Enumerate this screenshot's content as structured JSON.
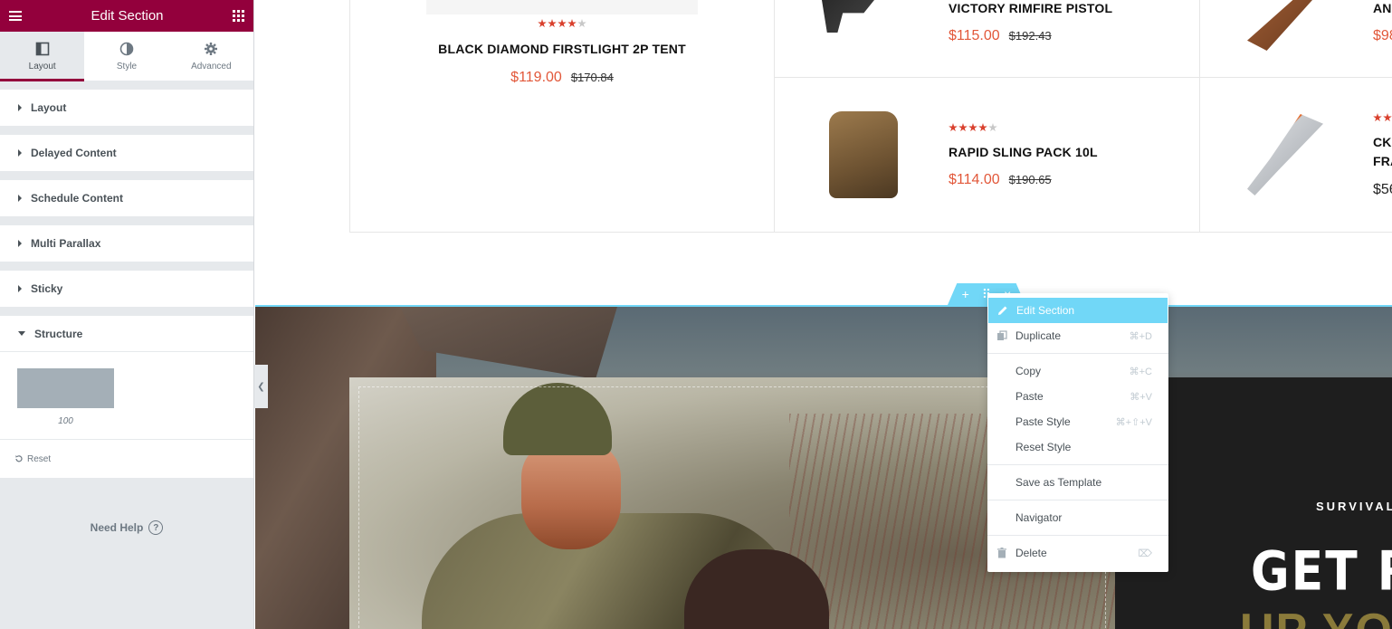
{
  "editor": {
    "panel_title": "Edit Section",
    "menu_icon": "hamburger-icon",
    "widgets_icon": "grid-icon",
    "tabs": [
      {
        "label": "Layout",
        "icon": "columns-icon",
        "active": true
      },
      {
        "label": "Style",
        "icon": "contrast-icon",
        "active": false
      },
      {
        "label": "Advanced",
        "icon": "gear-icon",
        "active": false
      }
    ],
    "sections": [
      {
        "label": "Layout",
        "open": false
      },
      {
        "label": "Delayed Content",
        "open": false
      },
      {
        "label": "Schedule Content",
        "open": false
      },
      {
        "label": "Multi Parallax",
        "open": false
      },
      {
        "label": "Sticky",
        "open": false
      },
      {
        "label": "Structure",
        "open": true
      }
    ],
    "structure_value": "100",
    "reset_label": "Reset",
    "help_label": "Need Help",
    "help_glyph": "?",
    "accent_color": "#93003c"
  },
  "products": {
    "tent": {
      "name": "BLACK DIAMOND FIRSTLIGHT 2P TENT",
      "price": "$119.00",
      "old_price": "$170.84",
      "rating": 4
    },
    "pistol": {
      "name": "VICTORY RIMFIRE PISTOL",
      "price": "$115.00",
      "old_price": "$192.43"
    },
    "sling": {
      "name": "RAPID SLING PACK 10L",
      "price": "$114.00",
      "old_price": "$190.65",
      "rating": 4
    },
    "partial_top": {
      "name": "AN",
      "price": "$98"
    },
    "partial_knife": {
      "name_line1": "CK",
      "name_line2": "FRA",
      "price": "$56"
    }
  },
  "hero": {
    "small_text": "SURVIVAL O",
    "big_text": "GET REA",
    "big_text2": "UP YOUR"
  },
  "context_menu": {
    "items": [
      {
        "label": "Edit Section",
        "shortcut": "",
        "icon": "pencil-icon",
        "highlighted": true
      },
      {
        "label": "Duplicate",
        "shortcut": "⌘+D",
        "icon": "duplicate-icon"
      },
      {
        "label": "Copy",
        "shortcut": "⌘+C"
      },
      {
        "label": "Paste",
        "shortcut": "⌘+V"
      },
      {
        "label": "Paste Style",
        "shortcut": "⌘+⇧+V"
      },
      {
        "label": "Reset Style",
        "shortcut": ""
      },
      {
        "label": "Save as Template",
        "shortcut": ""
      },
      {
        "label": "Navigator",
        "shortcut": ""
      },
      {
        "label": "Delete",
        "shortcut": "⌦",
        "icon": "trash-icon"
      }
    ],
    "highlight_color": "#71d7f7"
  },
  "section_handle": {
    "add": "+",
    "move": "⠿",
    "close": "×"
  }
}
